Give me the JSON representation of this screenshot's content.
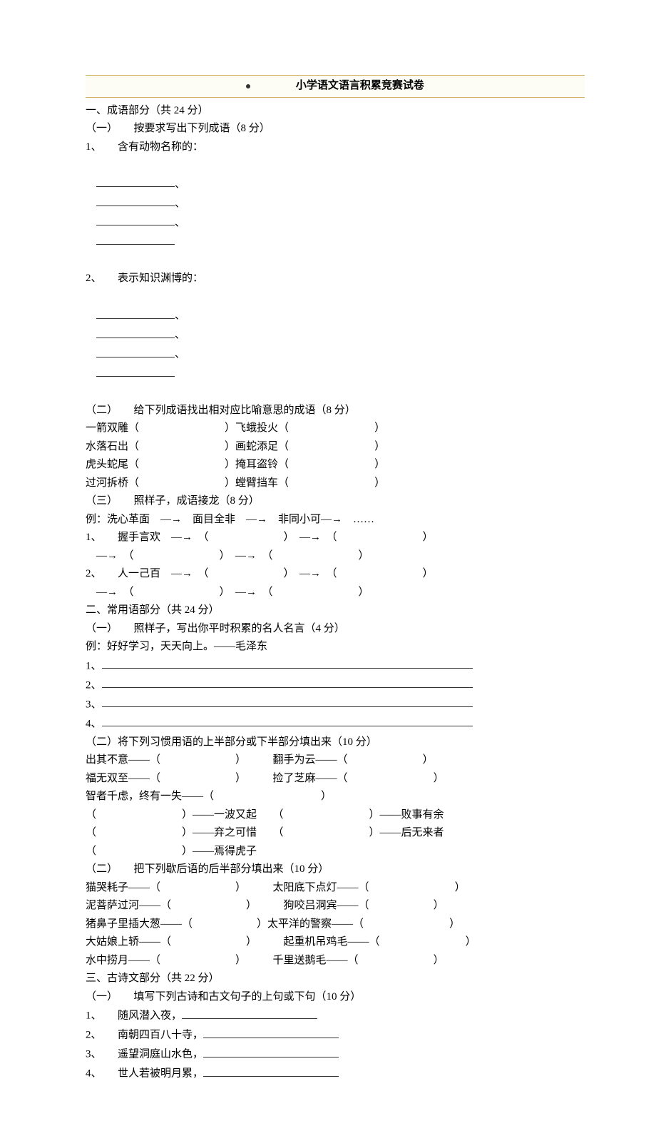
{
  "title": "小学语文语言积累竞赛试卷",
  "s1": {
    "heading": "一、成语部分（共 24 分）",
    "p1_heading": "（一）　　按要求写出下列成语（8 分）",
    "p1_item1": "1、　　含有动物名称的：",
    "p1_item2": "2、　　表示知识渊博的：",
    "p2_heading": "（二）　　给下列成语找出相对应比喻意思的成语（8 分）",
    "p2_l1a": "一箭双雕（",
    "p2_l1b": "）飞蛾投火（",
    "p2_l1c": "）",
    "p2_l2a": "水落石出（",
    "p2_l2b": "）画蛇添足（",
    "p2_l2c": "）",
    "p2_l3a": "虎头蛇尾（",
    "p2_l3b": "）掩耳盗铃（",
    "p2_l3c": "）",
    "p2_l4a": "过河拆桥（",
    "p2_l4b": "）螳臂挡车（",
    "p2_l4c": "）",
    "p3_heading": "（三）　　照样子，成语接龙（8 分）",
    "p3_example": "例：洗心革面　―→　面目全非　―→　非同小可―→　……",
    "p3_i1a": "1、　　握手言欢　―→　（　　　　　　　）　―→　（　　　　　　　　）",
    "p3_i1b": "　―→　（　　　　　　　　）　―→　（　　　　　　　　）",
    "p3_i2a": "2、　　人一己百　―→　（　　　　　　　）　―→　（　　　　　　　　）",
    "p3_i2b": "　―→　（　　　　　　　　）　―→　（　　　　　　　　）"
  },
  "s2": {
    "heading": "二、常用语部分（共 24 分）",
    "p1_heading": "（一）　　照样子，写出你平时积累的名人名言（4 分）",
    "p1_example": "例：好好学习，天天向上。——毛泽东",
    "p1_i1": "1、",
    "p1_i2": "2、",
    "p1_i3": "3、",
    "p1_i4": "4、",
    "p2_heading": "（二）将下列习惯用语的上半部分或下半部分填出来（10 分）",
    "p2_l1a": "出其不意——（",
    "p2_l1b": "）　　　翻手为云——（",
    "p2_l1c": "）",
    "p2_l2a": "福无双至——（",
    "p2_l2b": "）　　　捡了芝麻——（",
    "p2_l2c": "）",
    "p2_l3a": "智者千虑，终有一失——（",
    "p2_l3b": "）",
    "p2_l4a": "（　　　　　　　　）——一波又起　　（　　　　　　　　）——败事有余",
    "p2_l5a": "（　　　　　　　　）——弃之可惜　　（　　　　　　　　）——后无来者",
    "p2_l6a": "（　　　　　　　　）——焉得虎子",
    "p3_heading": "（二）　　把下列歇后语的后半部分填出来（10 分）",
    "p3_l1a": "猫哭耗子——（",
    "p3_l1b": "）　　　太阳底下点灯——（",
    "p3_l1c": "）",
    "p3_l2a": "泥菩萨过河——（",
    "p3_l2b": "）　　　狗咬吕洞宾——（",
    "p3_l2c": "）",
    "p3_l3a": "猪鼻子里插大葱——（",
    "p3_l3b": "）太平洋的警察——（",
    "p3_l3c": "）",
    "p3_l4a": "大姑娘上轿——（",
    "p3_l4b": "）　　　起重机吊鸡毛——（",
    "p3_l4c": "）",
    "p3_l5a": "水中捞月——（",
    "p3_l5b": "）　　　千里送鹅毛——（",
    "p3_l5c": "）"
  },
  "s3": {
    "heading": "三、古诗文部分（共 22 分）",
    "p1_heading": "（一）　　填写下列古诗和古文句子的上句或下句（10 分）",
    "p1_i1": "1、　　随风潜入夜，",
    "p1_i2": "2、　　南朝四百八十寺，",
    "p1_i3": "3、　　遥望洞庭山水色，",
    "p1_i4": "4、　　世人若被明月累，"
  }
}
